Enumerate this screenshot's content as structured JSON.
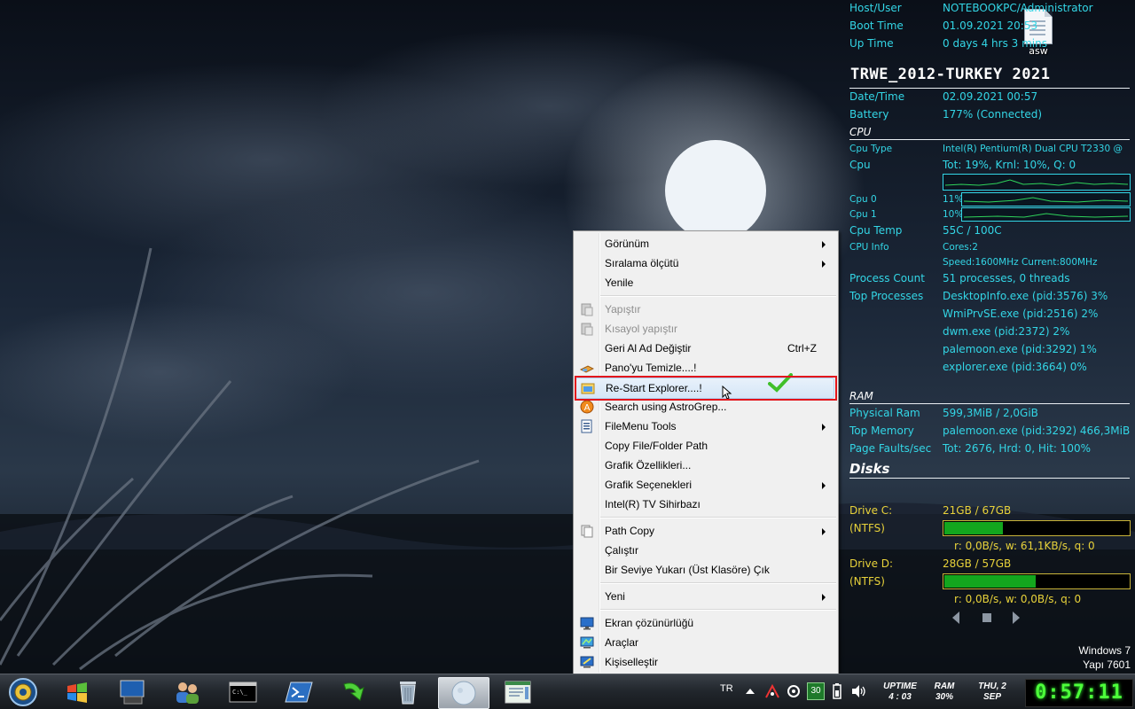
{
  "desktop": {
    "file_icon_label": "asw",
    "watermark": {
      "os": "Windows 7",
      "build": "Yapı 7601"
    }
  },
  "sysinfo": {
    "host_user": {
      "label": "Host/User",
      "value": "NOTEBOOKPC/Administrator"
    },
    "boot_time": {
      "label": "Boot Time",
      "value": "01.09.2021 20:53"
    },
    "up_time": {
      "label": "Up Time",
      "value": "0 days 4 hrs 3 mins"
    },
    "title": "TRWE_2012-TURKEY 2021",
    "date_time": {
      "label": "Date/Time",
      "value": "02.09.2021 00:57"
    },
    "battery": {
      "label": "Battery",
      "value": "177% (Connected)"
    },
    "cpu_section": "CPU",
    "cpu_type": {
      "label": "Cpu Type",
      "value": "Intel(R) Pentium(R) Dual  CPU  T2330  @"
    },
    "cpu": {
      "label": "Cpu",
      "value": "Tot: 19%, Krnl: 10%, Q: 0"
    },
    "cpu0": {
      "label": "Cpu 0",
      "value": "11%"
    },
    "cpu1": {
      "label": "Cpu 1",
      "value": "10%"
    },
    "cpu_temp": {
      "label": "Cpu Temp",
      "value": "55C / 100C"
    },
    "cpu_info": {
      "label": "CPU Info",
      "value1": "Cores:2",
      "value2": "Speed:1600MHz   Current:800MHz"
    },
    "process_count": {
      "label": "Process Count",
      "value": "51 processes, 0 threads"
    },
    "top_processes": {
      "label": "Top Processes",
      "items": [
        "DesktopInfo.exe (pid:3576) 3%",
        "WmiPrvSE.exe (pid:2516) 2%",
        "dwm.exe (pid:2372) 2%",
        "palemoon.exe (pid:3292) 1%",
        "explorer.exe (pid:3664) 0%"
      ]
    },
    "ram_section": "RAM",
    "physical_ram": {
      "label": "Physical Ram",
      "value": "599,3MiB / 2,0GiB"
    },
    "top_memory": {
      "label": "Top Memory",
      "value": "palemoon.exe (pid:3292) 466,3MiB"
    },
    "page_faults": {
      "label": "Page Faults/sec",
      "value": "Tot: 2676, Hrd: 0, Hit: 100%"
    },
    "disks_section": "Disks",
    "drive_c": {
      "label": "Drive C:",
      "fs": "(NTFS)",
      "value": "21GB / 67GB",
      "io": "r: 0,0B/s, w: 61,1KB/s, q: 0",
      "used_fraction": 0.313
    },
    "drive_d": {
      "label": "Drive D:",
      "fs": "(NTFS)",
      "value": "28GB / 57GB",
      "io": "r: 0,0B/s, w: 0,0B/s, q: 0",
      "used_fraction": 0.491
    }
  },
  "context_menu": {
    "items": [
      {
        "label": "Görünüm",
        "submenu": true
      },
      {
        "label": "Sıralama ölçütü",
        "submenu": true
      },
      {
        "label": "Yenile"
      },
      {
        "label": "Yapıştır",
        "disabled": true
      },
      {
        "label": "Kısayol yapıştır",
        "disabled": true
      },
      {
        "label": "Geri Al Ad Değiştir",
        "shortcut": "Ctrl+Z"
      },
      {
        "label": "Pano'yu Temizle....!"
      },
      {
        "label": "Re-Start Explorer....!"
      },
      {
        "label": "Search using AstroGrep..."
      },
      {
        "label": "FileMenu Tools",
        "submenu": true
      },
      {
        "label": "Copy File/Folder Path"
      },
      {
        "label": "Grafik Özellikleri..."
      },
      {
        "label": "Grafik Seçenekleri",
        "submenu": true
      },
      {
        "label": "Intel(R) TV Sihirbazı"
      },
      {
        "label": "Path Copy",
        "submenu": true
      },
      {
        "label": "Çalıştır"
      },
      {
        "label": "Bir Seviye Yukarı (Üst Klasöre) Çık"
      },
      {
        "label": "Yeni",
        "submenu": true
      },
      {
        "label": "Ekran çözünürlüğü"
      },
      {
        "label": "Araçlar"
      },
      {
        "label": "Kişiselleştir"
      }
    ]
  },
  "taskbar": {
    "language": "TR",
    "battery_badge": "30",
    "uptime": {
      "label": "UPTIME",
      "value": "4 : 03"
    },
    "ram": {
      "label": "RAM",
      "value": "30%"
    },
    "date": {
      "day": "THU, 2",
      "month": "SEP"
    },
    "clock": "0:57:11"
  },
  "colors": {
    "sysinfo_text": "#33d6e6",
    "highlight_box": "#e3141b",
    "disk_fill": "#13a61e",
    "clock": "#4dff3a"
  }
}
